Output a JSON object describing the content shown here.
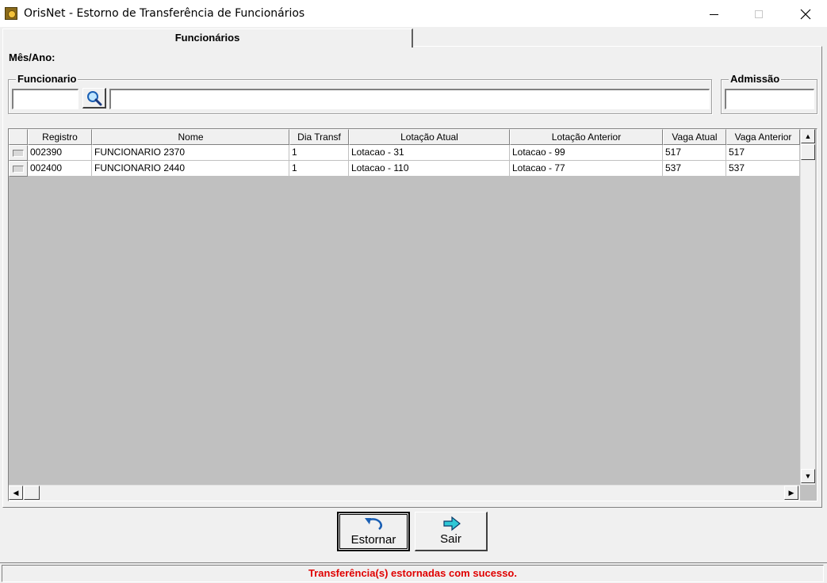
{
  "window": {
    "title": "OrisNet - Estorno de Transferência de Funcionários",
    "app_icon": "orisnet-app-icon",
    "controls": [
      "minimize",
      "maximize",
      "close"
    ]
  },
  "tab": {
    "label": "Funcionários"
  },
  "filters": {
    "mes_ano_label": "Mês/Ano:",
    "funcionario_legend": "Funcionario",
    "funcionario_code_value": "",
    "funcionario_name_value": "",
    "search_icon": "magnifier-icon",
    "admissao_legend": "Admissão",
    "admissao_value": ""
  },
  "grid": {
    "columns": [
      "Registro",
      "Nome",
      "Dia Transf",
      "Lotação Atual",
      "Lotação Anterior",
      "Vaga Atual",
      "Vaga Anterior"
    ],
    "rows": [
      {
        "registro": "002390",
        "nome": "FUNCIONARIO 2370",
        "dia_transf": "1",
        "lotacao_atual": "Lotacao - 31",
        "lotacao_anterior": "Lotacao - 99",
        "vaga_atual": "517",
        "vaga_anterior": "517"
      },
      {
        "registro": "002400",
        "nome": "FUNCIONARIO 2440",
        "dia_transf": "1",
        "lotacao_atual": "Lotacao - 110",
        "lotacao_anterior": "Lotacao - 77",
        "vaga_atual": "537",
        "vaga_anterior": "537"
      }
    ]
  },
  "buttons": {
    "estornar_label": "Estornar",
    "estornar_icon": "undo-arrow-icon",
    "sair_label": "Sair",
    "sair_icon": "right-arrow-icon"
  },
  "status": {
    "message": "Transferência(s) estornadas com sucesso.",
    "color": "#e00000"
  }
}
